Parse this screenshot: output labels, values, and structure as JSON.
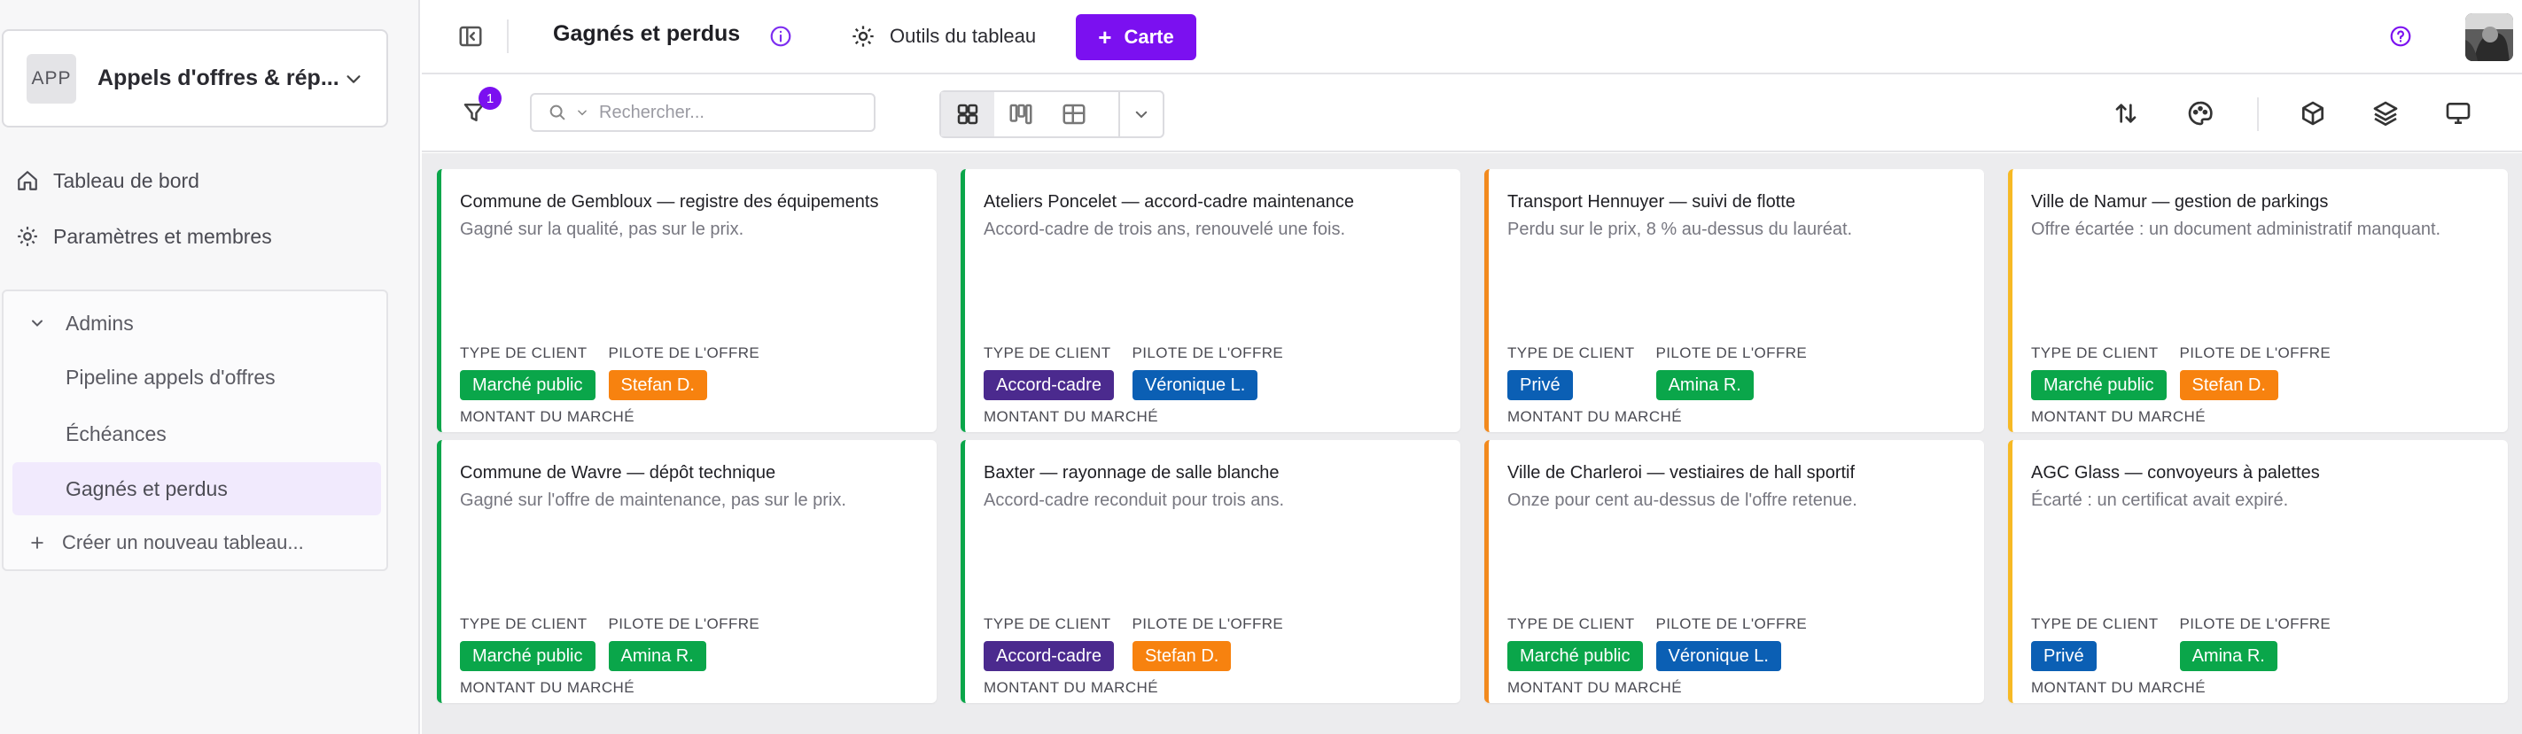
{
  "sidebar": {
    "app_badge": "APP",
    "app_name": "Appels d'offres & rép...",
    "nav": [
      {
        "label": "Tableau de bord",
        "icon": "home-icon"
      },
      {
        "label": "Paramètres et membres",
        "icon": "gear-icon"
      }
    ],
    "group": {
      "label": "Admins",
      "items": [
        {
          "label": "Pipeline appels d'offres"
        },
        {
          "label": "Échéances"
        },
        {
          "label": "Gagnés et perdus",
          "active": true
        }
      ],
      "create_label": "Créer un nouveau tableau..."
    }
  },
  "topbar": {
    "board_title": "Gagnés et perdus",
    "tools_label": "Outils du tableau",
    "add_card_label": "Carte"
  },
  "toolbar": {
    "filter_count": "1",
    "search_placeholder": "Rechercher..."
  },
  "colors": {
    "accent": "#7b10f0",
    "won": "#0aa64a",
    "lost": "#f28a1e",
    "rejected": "#f7b924",
    "tag_marche_public": "#0aa64a",
    "tag_accord_cadre": "#4b2a8e",
    "tag_prive": "#0b5fb4",
    "tag_stefan": "#f7820f",
    "tag_veronique": "#0b5fb4",
    "tag_amina": "#0aa64a"
  },
  "labels": {
    "client_type": "TYPE DE CLIENT",
    "bid_pilot": "PILOTE DE L'OFFRE",
    "amount": "MONTANT DU MARCHÉ"
  },
  "cards": [
    {
      "title": "Commune de Gembloux — registre des équipements",
      "subtitle": "Gagné sur la qualité, pas sur le prix.",
      "status": "won",
      "client": "Marché public",
      "client_color": "#0aa64a",
      "pilot": "Stefan D.",
      "pilot_color": "#f7820f"
    },
    {
      "title": "Ateliers Poncelet — accord-cadre maintenance",
      "subtitle": "Accord-cadre de trois ans, renouvelé une fois.",
      "status": "won",
      "client": "Accord-cadre",
      "client_color": "#4b2a8e",
      "pilot": "Véronique L.",
      "pilot_color": "#0b5fb4"
    },
    {
      "title": "Transport Hennuyer — suivi de flotte",
      "subtitle": "Perdu sur le prix, 8 % au-dessus du lauréat.",
      "status": "lost",
      "client": "Privé",
      "client_color": "#0b5fb4",
      "pilot": "Amina R.",
      "pilot_color": "#0aa64a"
    },
    {
      "title": "Ville de Namur — gestion de parkings",
      "subtitle": "Offre écartée : un document administratif manquant.",
      "status": "rejected",
      "client": "Marché public",
      "client_color": "#0aa64a",
      "pilot": "Stefan D.",
      "pilot_color": "#f7820f"
    },
    {
      "title": "Commune de Wavre — dépôt technique",
      "subtitle": "Gagné sur l'offre de maintenance, pas sur le prix.",
      "status": "won",
      "client": "Marché public",
      "client_color": "#0aa64a",
      "pilot": "Amina R.",
      "pilot_color": "#0aa64a"
    },
    {
      "title": "Baxter — rayonnage de salle blanche",
      "subtitle": "Accord-cadre reconduit pour trois ans.",
      "status": "won",
      "client": "Accord-cadre",
      "client_color": "#4b2a8e",
      "pilot": "Stefan D.",
      "pilot_color": "#f7820f"
    },
    {
      "title": "Ville de Charleroi — vestiaires de hall sportif",
      "subtitle": "Onze pour cent au-dessus de l'offre retenue.",
      "status": "lost",
      "client": "Marché public",
      "client_color": "#0aa64a",
      "pilot": "Véronique L.",
      "pilot_color": "#0b5fb4"
    },
    {
      "title": "AGC Glass — convoyeurs à palettes",
      "subtitle": "Écarté : un certificat avait expiré.",
      "status": "rejected",
      "client": "Privé",
      "client_color": "#0b5fb4",
      "pilot": "Amina R.",
      "pilot_color": "#0aa64a"
    }
  ]
}
